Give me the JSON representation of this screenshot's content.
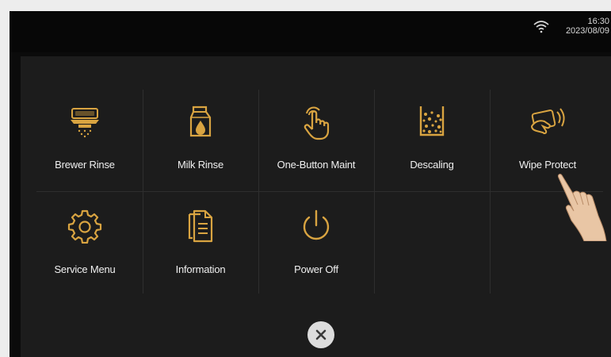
{
  "status": {
    "time": "16:30",
    "date": "2023/08/09",
    "wifi_icon": "wifi-icon"
  },
  "menu": {
    "accent_color": "#d9a441",
    "items": [
      {
        "label": "Brewer Rinse",
        "icon": "brewer-icon"
      },
      {
        "label": "Milk Rinse",
        "icon": "milk-carton-icon"
      },
      {
        "label": "One-Button Maint",
        "icon": "touch-finger-icon"
      },
      {
        "label": "Descaling",
        "icon": "descaling-beaker-icon"
      },
      {
        "label": "Wipe Protect",
        "icon": "wipe-hand-icon"
      },
      {
        "label": "Service Menu",
        "icon": "gear-icon"
      },
      {
        "label": "Information",
        "icon": "documents-icon"
      },
      {
        "label": "Power Off",
        "icon": "power-icon"
      }
    ]
  },
  "close_icon": "close-icon"
}
